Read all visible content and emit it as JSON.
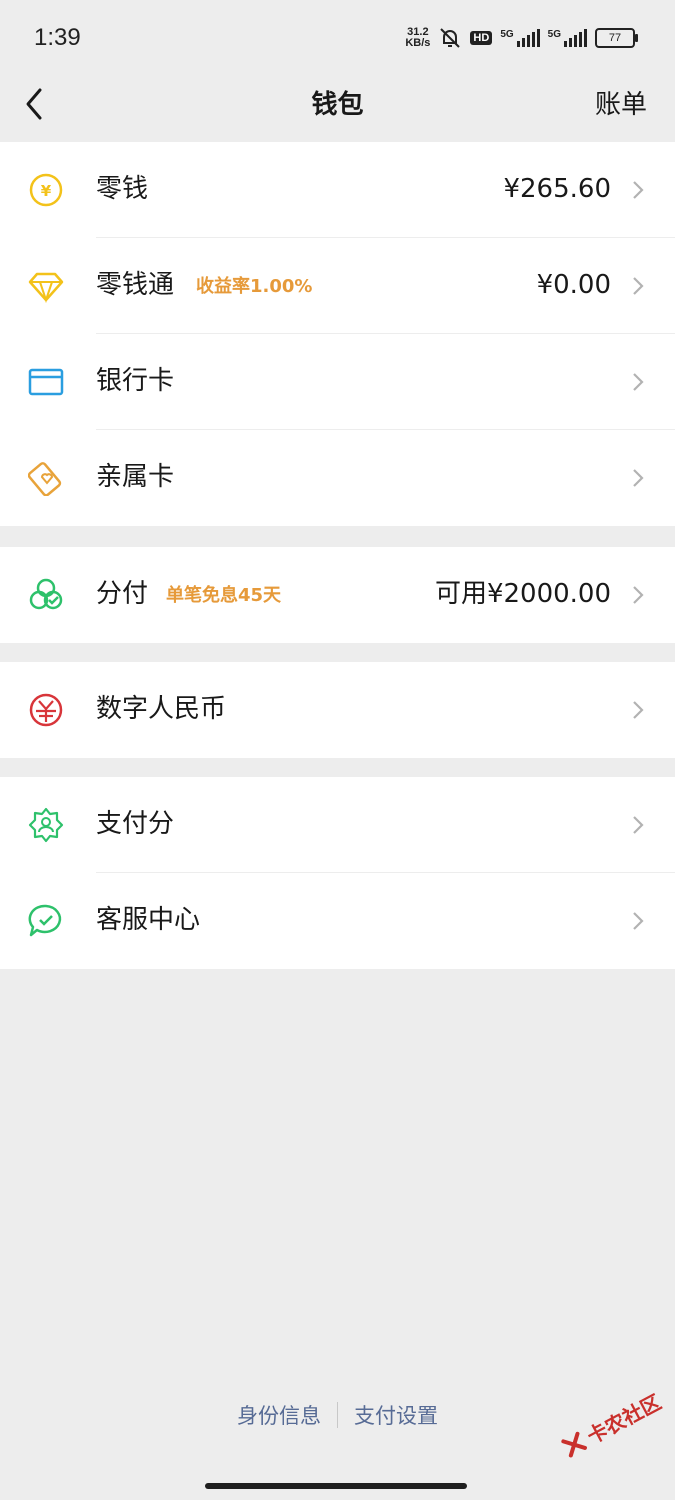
{
  "status_bar": {
    "time": "1:39",
    "speed_value": "31.2",
    "speed_unit": "KB/s",
    "hd": "HD",
    "network1": "5G",
    "network2": "5G",
    "battery": "77"
  },
  "header": {
    "title": "钱包",
    "right_action": "账单"
  },
  "group1": [
    {
      "label": "零钱",
      "tag": "",
      "value": "¥265.60",
      "icon": "yuan-coin-icon",
      "color": "#f3c21a"
    },
    {
      "label": "零钱通",
      "tag": "收益率1.00%",
      "value": "¥0.00",
      "icon": "diamond-icon",
      "color": "#f3c21a"
    },
    {
      "label": "银行卡",
      "tag": "",
      "value": "",
      "icon": "bank-card-icon",
      "color": "#2a9ee0"
    },
    {
      "label": "亲属卡",
      "tag": "",
      "value": "",
      "icon": "family-card-icon",
      "color": "#e8a33a"
    }
  ],
  "group2": [
    {
      "label": "分付",
      "tag": "单笔免息45天",
      "value": "可用¥2000.00",
      "icon": "fenfu-icon",
      "color": "#2ec16b"
    }
  ],
  "group3": [
    {
      "label": "数字人民币",
      "tag": "",
      "value": "",
      "icon": "digital-rmb-icon",
      "color": "#d8353a"
    }
  ],
  "group4": [
    {
      "label": "支付分",
      "tag": "",
      "value": "",
      "icon": "pay-score-icon",
      "color": "#2ec16b"
    },
    {
      "label": "客服中心",
      "tag": "",
      "value": "",
      "icon": "customer-service-icon",
      "color": "#2ec16b"
    }
  ],
  "footer": {
    "identity": "身份信息",
    "settings": "支付设置"
  },
  "watermark": {
    "text": "卡农社区"
  }
}
